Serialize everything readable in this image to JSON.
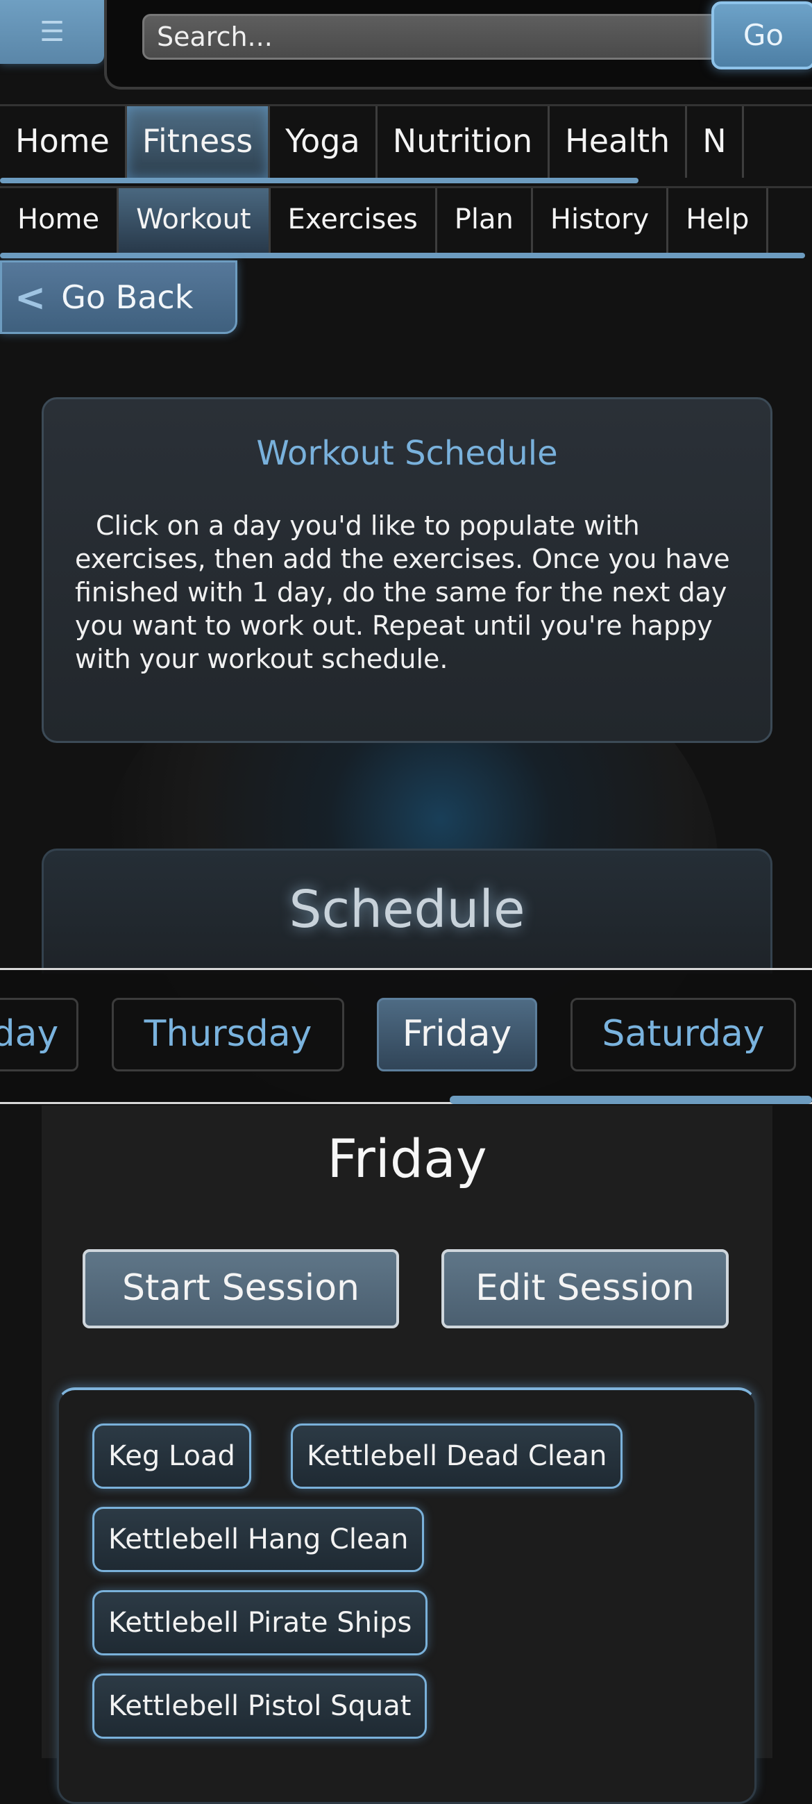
{
  "header": {
    "menu_icon": "hamburger-menu-icon",
    "search_placeholder": "Search...",
    "go_label": "Go"
  },
  "nav_primary": [
    "Home",
    "Fitness",
    "Yoga",
    "Nutrition",
    "Health",
    "N"
  ],
  "nav_secondary": [
    "Home",
    "Workout",
    "Exercises",
    "Plan",
    "History",
    "Help"
  ],
  "back": {
    "icon": "chevron-left-icon",
    "label": "Go Back"
  },
  "info": {
    "title": "Workout Schedule",
    "text": "Click on a day you'd like to populate with exercises, then add the exercises. Once you have finished with 1 day, do the same for the next day you want to work out. Repeat until you're happy with your workout schedule."
  },
  "schedule": {
    "title": "Schedule",
    "days": [
      "day",
      "Thursday",
      "Friday",
      "Saturday"
    ],
    "selected_day": "Friday"
  },
  "day_panel": {
    "title": "Friday",
    "start_label": "Start Session",
    "edit_label": "Edit Session",
    "exercises": [
      "Keg Load",
      "Kettlebell Dead Clean",
      "Kettlebell Hang Clean",
      "Kettlebell Pirate Ships",
      "Kettlebell Pistol Squat"
    ]
  },
  "colors": {
    "accent": "#79b1dc",
    "background": "#121212"
  }
}
